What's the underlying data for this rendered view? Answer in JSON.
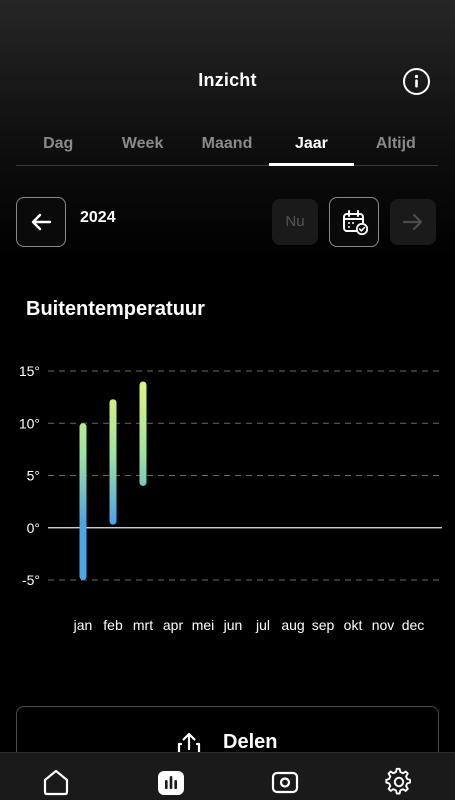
{
  "header": {
    "title": "Inzicht",
    "info_icon": "info-icon"
  },
  "tabs": [
    {
      "label": "Dag",
      "active": false
    },
    {
      "label": "Week",
      "active": false
    },
    {
      "label": "Maand",
      "active": false
    },
    {
      "label": "Jaar",
      "active": true
    },
    {
      "label": "Altijd",
      "active": false
    }
  ],
  "period": {
    "prev_icon": "arrow-left-icon",
    "year": "2024",
    "now_label": "Nu",
    "now_enabled": false,
    "calendar_icon": "calendar-check-icon",
    "next_icon": "arrow-right-icon",
    "next_enabled": false
  },
  "section": {
    "title": "Buitentemperatuur"
  },
  "chart_data": {
    "type": "bar",
    "subtype": "range",
    "categories": [
      "jan",
      "feb",
      "mrt",
      "apr",
      "mei",
      "jun",
      "jul",
      "aug",
      "sep",
      "okt",
      "nov",
      "dec"
    ],
    "ranges": [
      {
        "category": "jan",
        "min": -5,
        "max": 10
      },
      {
        "category": "feb",
        "min": 0.3,
        "max": 12.3
      },
      {
        "category": "mrt",
        "min": 4,
        "max": 14
      }
    ],
    "y_ticks": [
      "15°",
      "10°",
      "5°",
      "0°",
      "-5°"
    ],
    "y_tick_values": [
      15,
      10,
      5,
      0,
      -5
    ],
    "ylim": [
      -5,
      15
    ],
    "grid": "dashed",
    "gradient_colors": {
      "warm": "#ecf57a",
      "mid": "#9fe3a0",
      "cold": "#4fa6e6"
    }
  },
  "share": {
    "label": "Delen",
    "icon": "share-icon"
  },
  "bottom_nav": [
    {
      "name": "home",
      "icon": "home-icon",
      "active": false
    },
    {
      "name": "insights",
      "icon": "chart-icon",
      "active": true
    },
    {
      "name": "device",
      "icon": "device-icon",
      "active": false
    },
    {
      "name": "settings",
      "icon": "gear-icon",
      "active": false
    }
  ]
}
